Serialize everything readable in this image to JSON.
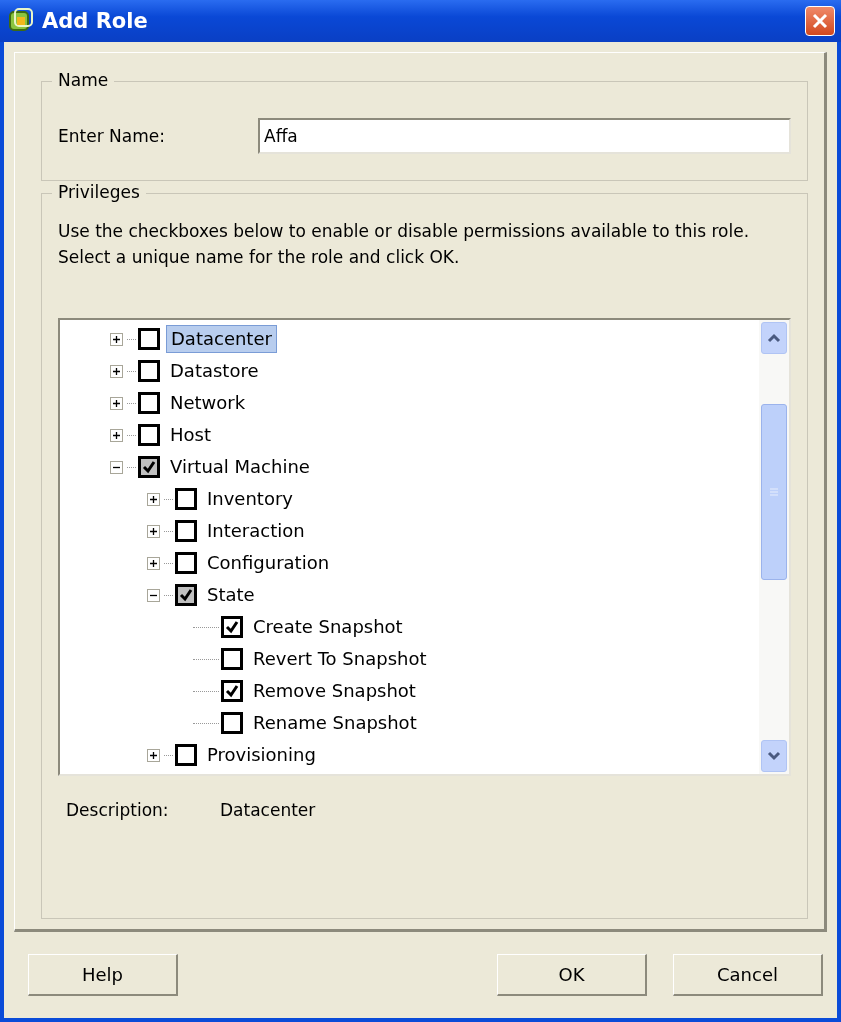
{
  "window": {
    "title": "Add Role"
  },
  "name_group": {
    "legend": "Name",
    "label": "Enter Name:",
    "value": "Affa"
  },
  "privileges_group": {
    "legend": "Privileges",
    "instructions": "Use the checkboxes below to enable or disable permissions available to this role. Select a unique name for the role and click OK.",
    "tree": [
      {
        "label": "Datacenter",
        "checked": false,
        "selected": true,
        "expanded": false
      },
      {
        "label": "Datastore",
        "checked": false,
        "selected": false,
        "expanded": false
      },
      {
        "label": "Network",
        "checked": false,
        "selected": false,
        "expanded": false
      },
      {
        "label": "Host",
        "checked": false,
        "selected": false,
        "expanded": false
      },
      {
        "label": "Virtual Machine",
        "checked": true,
        "selected": false,
        "expanded": true,
        "children": [
          {
            "label": "Inventory",
            "checked": false,
            "selected": false,
            "expanded": false
          },
          {
            "label": "Interaction",
            "checked": false,
            "selected": false,
            "expanded": false
          },
          {
            "label": "Configuration",
            "checked": false,
            "selected": false,
            "expanded": false
          },
          {
            "label": "State",
            "checked": true,
            "selected": false,
            "expanded": true,
            "children": [
              {
                "label": "Create Snapshot",
                "checked": true,
                "selected": false
              },
              {
                "label": "Revert To Snapshot",
                "checked": false,
                "selected": false
              },
              {
                "label": "Remove Snapshot",
                "checked": true,
                "selected": false
              },
              {
                "label": "Rename Snapshot",
                "checked": false,
                "selected": false
              }
            ]
          },
          {
            "label": "Provisioning",
            "checked": false,
            "selected": false,
            "expanded": false
          }
        ]
      }
    ],
    "description_label": "Description:",
    "description_value": "Datacenter"
  },
  "buttons": {
    "left": [
      "Help"
    ],
    "right": [
      "OK",
      "Cancel"
    ]
  }
}
